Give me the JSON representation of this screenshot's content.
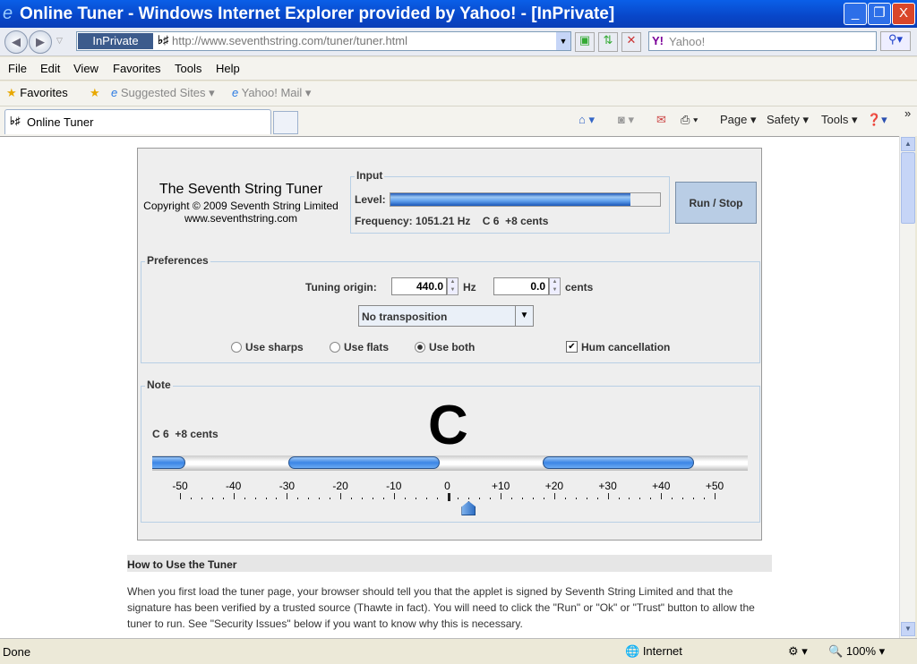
{
  "window": {
    "title": "Online Tuner - Windows Internet Explorer provided by Yahoo! - [InPrivate]",
    "minimize": "_",
    "restore": "❐",
    "close": "X"
  },
  "address": {
    "inprivate": "InPrivate",
    "url": "http://www.seventhstring.com/tuner/tuner.html",
    "search_placeholder": "Yahoo!"
  },
  "menu": [
    "File",
    "Edit",
    "View",
    "Favorites",
    "Tools",
    "Help"
  ],
  "favorites": {
    "label": "Favorites",
    "suggested": "Suggested Sites",
    "yahoo_mail": "Yahoo! Mail"
  },
  "tab": {
    "label": "Online Tuner"
  },
  "toolbar": {
    "page": "Page",
    "safety": "Safety",
    "tools": "Tools"
  },
  "applet": {
    "title": "The Seventh String Tuner",
    "copyright": "Copyright © 2009 Seventh String Limited",
    "website": "www.seventhstring.com",
    "input": {
      "legend": "Input",
      "level_label": "Level:",
      "level_percent": 89,
      "frequency": "Frequency: 1051.21 Hz    C 6  +8 cents"
    },
    "run_stop": "Run / Stop",
    "preferences": {
      "legend": "Preferences",
      "tuning_origin_label": "Tuning origin:",
      "hz_value": "440.0",
      "hz_unit": "Hz",
      "cents_value": "0.0",
      "cents_unit": "cents",
      "transposition": "No transposition",
      "radios": [
        {
          "label": "Use sharps",
          "checked": false
        },
        {
          "label": "Use flats",
          "checked": false
        },
        {
          "label": "Use both",
          "checked": true
        }
      ],
      "hum_cancellation": {
        "label": "Hum cancellation",
        "checked": true
      }
    },
    "note": {
      "legend": "Note",
      "reading": "C 6  +8 cents",
      "big_note": "C",
      "scale_labels": [
        "-50",
        "-40",
        "-30",
        "-20",
        "-10",
        "0",
        "+10",
        "+20",
        "+30",
        "+40",
        "+50"
      ],
      "needle_cents": 4
    }
  },
  "howto": {
    "heading": "How to Use the Tuner",
    "text": "When you first load the tuner page, your browser should tell you that the applet is signed by Seventh String Limited and that the signature has been verified by a trusted source (Thawte in fact). You will need to click the \"Run\" or \"Ok\" or \"Trust\" button to allow the tuner to run. See \"Security Issues\" below if you want to know why this is necessary."
  },
  "status": {
    "left": "Done",
    "zone": "Internet",
    "zoom": "100%"
  },
  "colors": {
    "titlebar": "#0846c8",
    "accent_blue": "#3c86e6",
    "run_button": "#b9cde5"
  }
}
